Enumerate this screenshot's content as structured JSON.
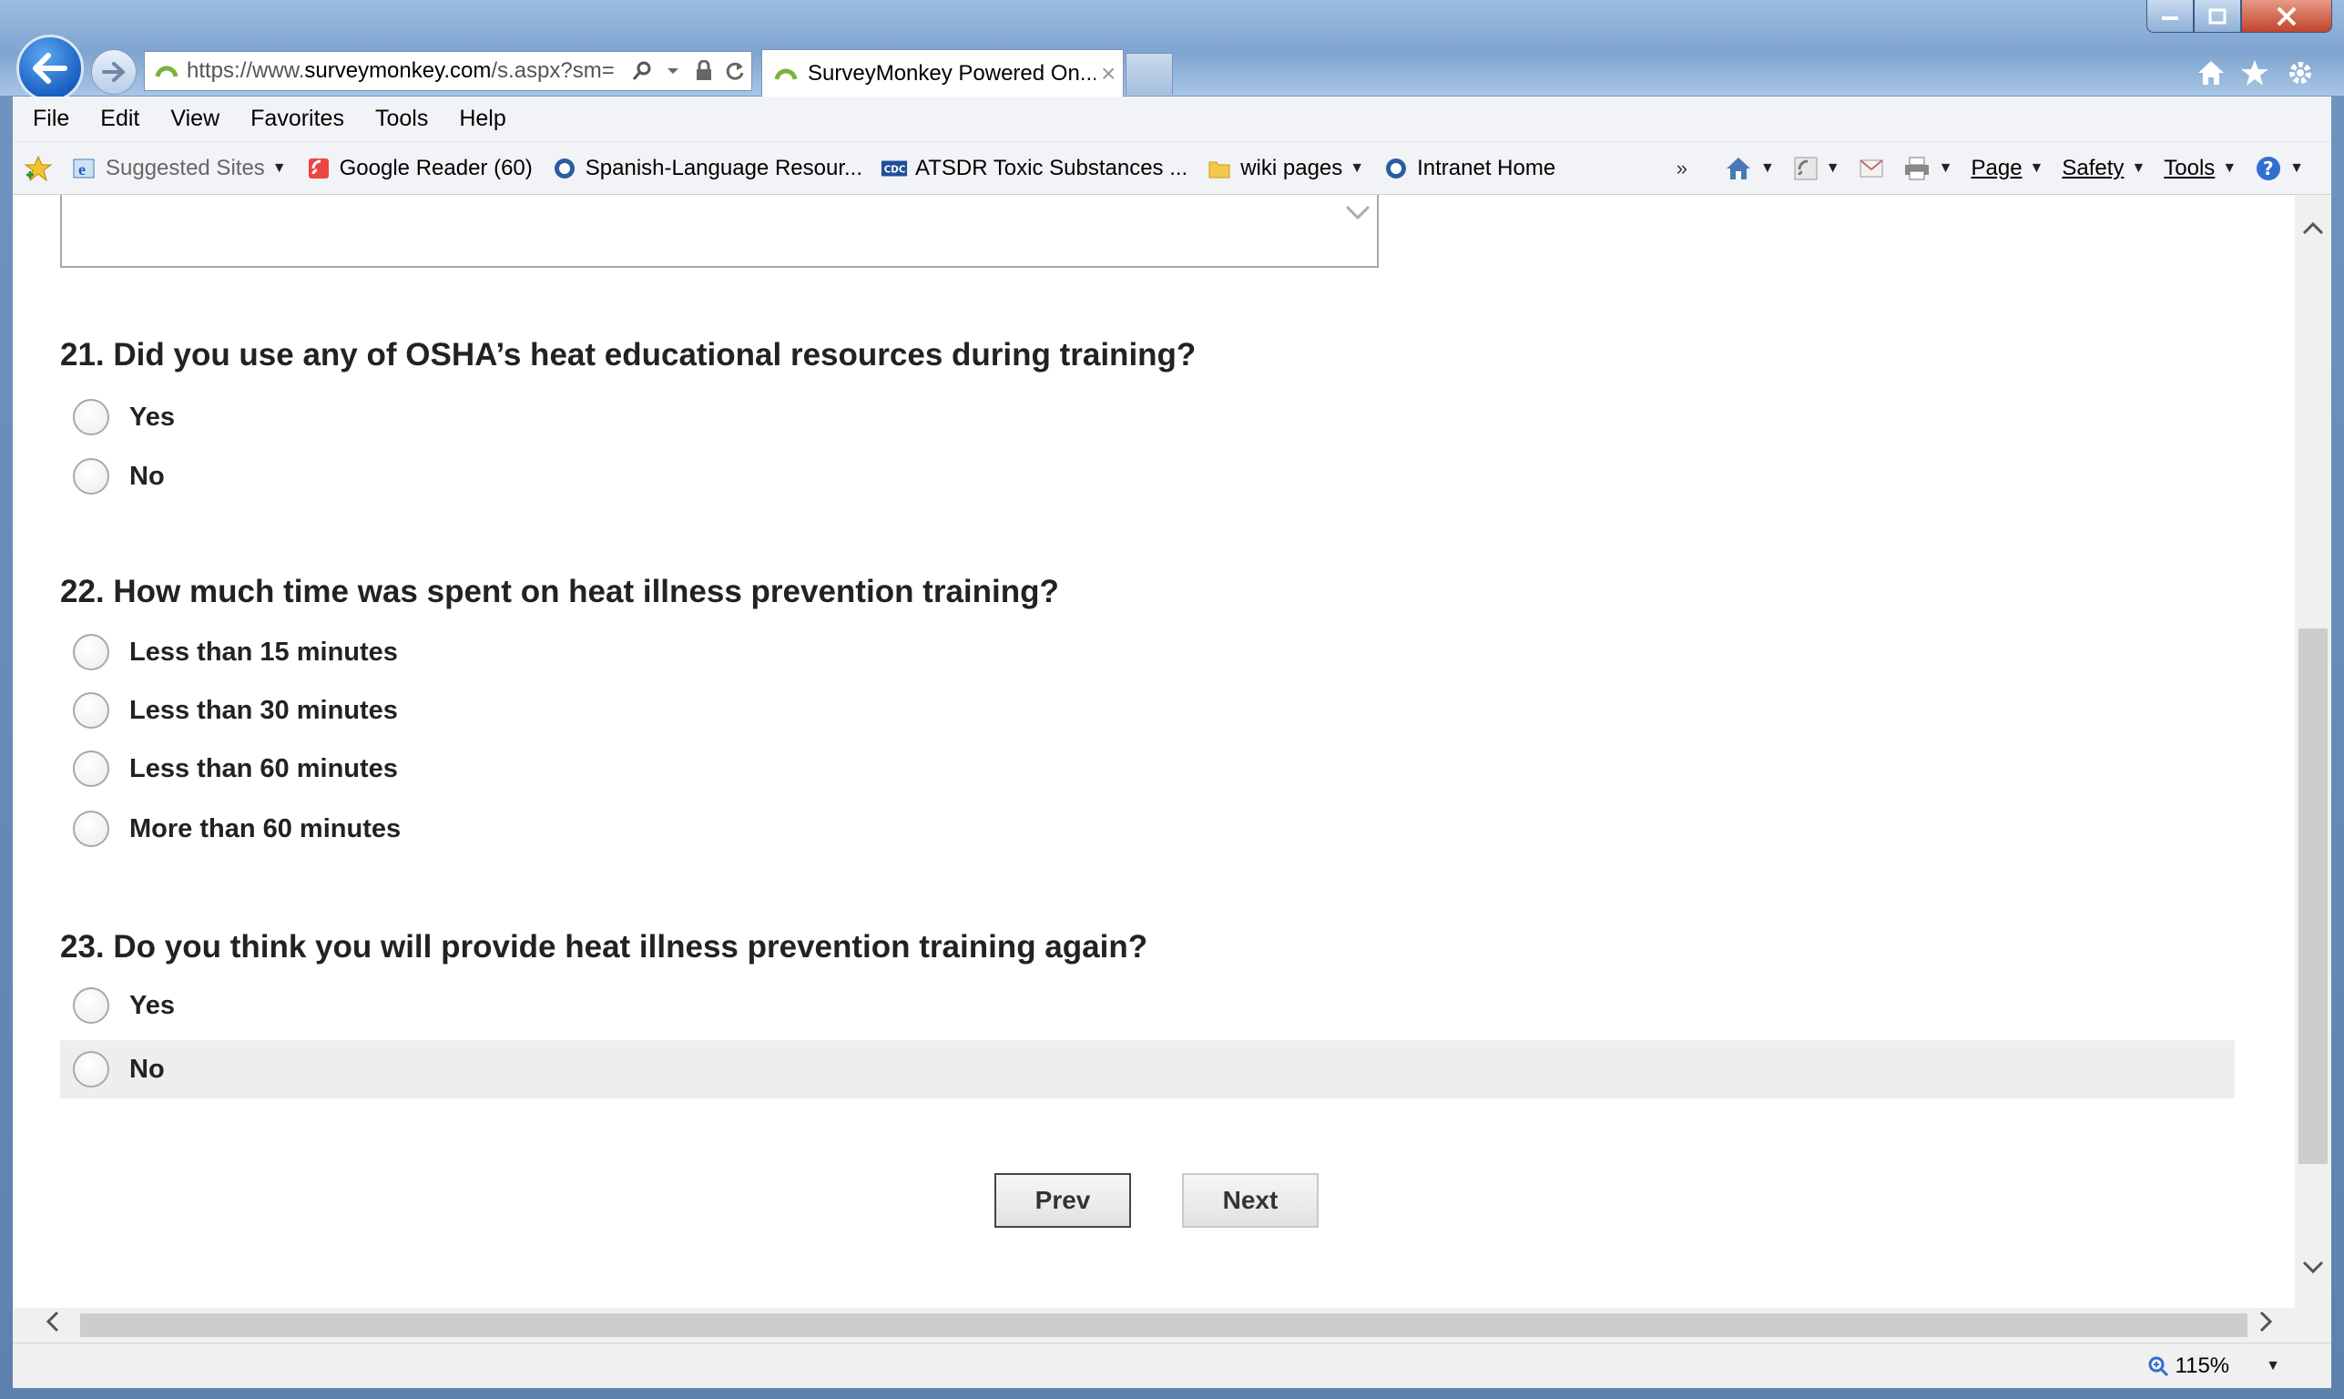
{
  "browser": {
    "address": {
      "url_prefix": "https://www.",
      "url_domain": "surveymonkey.com",
      "url_suffix": "/s.aspx?sm="
    },
    "tab": {
      "title": "SurveyMonkey Powered On...",
      "close": "×"
    },
    "menu": [
      "File",
      "Edit",
      "View",
      "Favorites",
      "Tools",
      "Help"
    ],
    "favorites": [
      {
        "label": "Suggested Sites",
        "icon": "ie-icon"
      },
      {
        "label": "Google Reader (60)",
        "icon": "google-reader-icon"
      },
      {
        "label": "Spanish-Language Resour...",
        "icon": "globe-icon"
      },
      {
        "label": "ATSDR Toxic Substances ...",
        "icon": "cdc-icon"
      },
      {
        "label": "wiki pages",
        "icon": "folder-icon"
      },
      {
        "label": "Intranet Home",
        "icon": "globe-icon"
      }
    ],
    "overflow": "»",
    "commands": {
      "page": "Page",
      "safety": "Safety",
      "tools": "Tools"
    },
    "zoom": "115%"
  },
  "survey": {
    "questions": [
      {
        "text": "21. Did you use any of OSHA’s heat educational resources during training?",
        "options": [
          "Yes",
          "No"
        ]
      },
      {
        "text": "22. How much time was spent on heat illness prevention training?",
        "options": [
          "Less than 15 minutes",
          "Less than 30 minutes",
          "Less than 60 minutes",
          "More than 60 minutes"
        ]
      },
      {
        "text": "23. Do you think you will provide heat illness prevention training again?",
        "options": [
          "Yes",
          "No"
        ]
      }
    ],
    "prev_label": "Prev",
    "next_label": "Next"
  },
  "colors": {
    "accent_back": "#1a5fc2",
    "window_frame": "#6f93bf",
    "highlight_row": "#eeeeee"
  }
}
